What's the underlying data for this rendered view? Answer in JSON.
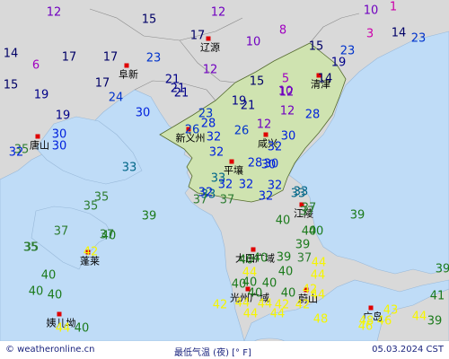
{
  "colors": {
    "temp_0": "#cc00aa",
    "temp_5": "#a000c0",
    "temp_10": "#7000c0",
    "temp_15": "#000066",
    "temp_20": "#000088",
    "temp_25": "#0033cc",
    "temp_30": "#0022dd",
    "temp_33": "#006688",
    "temp_35": "#2e7d32",
    "temp_40": "#1b7a1b",
    "temp_44": "#f5f500",
    "sea": "#bfdcf7",
    "land": "#d9d9d9",
    "korea": "#cfe3b0"
  },
  "footer": {
    "site": "© weatheronline.cn",
    "title": "最低气温 (夜) [° F]",
    "date": "05.03.2024 CST"
  },
  "cities": [
    {
      "name": "辽源"
    },
    {
      "name": "阜新"
    },
    {
      "name": "清津"
    },
    {
      "name": "唐山"
    },
    {
      "name": "新义州"
    },
    {
      "name": "咸兴"
    },
    {
      "name": "平壤"
    },
    {
      "name": "江陵"
    },
    {
      "name": "蓬莱"
    },
    {
      "name": "大田广域"
    },
    {
      "name": "光州广域"
    },
    {
      "name": "蔚山"
    },
    {
      "name": "姨儿坳"
    },
    {
      "name": "广岛"
    }
  ],
  "temps": [
    {
      "v": "12"
    },
    {
      "v": "15"
    },
    {
      "v": "12"
    },
    {
      "v": "10"
    },
    {
      "v": "1"
    },
    {
      "v": "17"
    },
    {
      "v": "10"
    },
    {
      "v": "8"
    },
    {
      "v": "15"
    },
    {
      "v": "3"
    },
    {
      "v": "14"
    },
    {
      "v": "23"
    },
    {
      "v": "14"
    },
    {
      "v": "6"
    },
    {
      "v": "17"
    },
    {
      "v": "17"
    },
    {
      "v": "23"
    },
    {
      "v": "12"
    },
    {
      "v": "19"
    },
    {
      "v": "23"
    },
    {
      "v": "15"
    },
    {
      "v": "19"
    },
    {
      "v": "17"
    },
    {
      "v": "21"
    },
    {
      "v": "15"
    },
    {
      "v": "5"
    },
    {
      "v": "14"
    },
    {
      "v": "24"
    },
    {
      "v": "21"
    },
    {
      "v": "12"
    },
    {
      "v": "10"
    },
    {
      "v": "19"
    },
    {
      "v": "21"
    },
    {
      "v": "30"
    },
    {
      "v": "19"
    },
    {
      "v": "21"
    },
    {
      "v": "12"
    },
    {
      "v": "28"
    },
    {
      "v": "23"
    },
    {
      "v": "28"
    },
    {
      "v": "12"
    },
    {
      "v": "30"
    },
    {
      "v": "26"
    },
    {
      "v": "32"
    },
    {
      "v": "26"
    },
    {
      "v": "30"
    },
    {
      "v": "35"
    },
    {
      "v": "30"
    },
    {
      "v": "32"
    },
    {
      "v": "32"
    },
    {
      "v": "30"
    },
    {
      "v": "32"
    },
    {
      "v": "28"
    },
    {
      "v": "30"
    },
    {
      "v": "33"
    },
    {
      "v": "33"
    },
    {
      "v": "32"
    },
    {
      "v": "32"
    },
    {
      "v": "32"
    },
    {
      "v": "33"
    },
    {
      "v": "33"
    },
    {
      "v": "37"
    },
    {
      "v": "37"
    },
    {
      "v": "32"
    },
    {
      "v": "33"
    },
    {
      "v": "32"
    },
    {
      "v": "37"
    },
    {
      "v": "35"
    },
    {
      "v": "35"
    },
    {
      "v": "39"
    },
    {
      "v": "37"
    },
    {
      "v": "40"
    },
    {
      "v": "39"
    },
    {
      "v": "37"
    },
    {
      "v": "37"
    },
    {
      "v": "40"
    },
    {
      "v": "40"
    },
    {
      "v": "35"
    },
    {
      "v": "35"
    },
    {
      "v": "42"
    },
    {
      "v": "40"
    },
    {
      "v": "40"
    },
    {
      "v": "39"
    },
    {
      "v": "37"
    },
    {
      "v": "39"
    },
    {
      "v": "40"
    },
    {
      "v": "40"
    },
    {
      "v": "40"
    },
    {
      "v": "44"
    },
    {
      "v": "40"
    },
    {
      "v": "40"
    },
    {
      "v": "44"
    },
    {
      "v": "40"
    },
    {
      "v": "40"
    },
    {
      "v": "44"
    },
    {
      "v": "40"
    },
    {
      "v": "40"
    },
    {
      "v": "44"
    },
    {
      "v": "40"
    },
    {
      "v": "42"
    },
    {
      "v": "44"
    },
    {
      "v": "44"
    },
    {
      "v": "42"
    },
    {
      "v": "44"
    },
    {
      "v": "42"
    },
    {
      "v": "42"
    },
    {
      "v": "44"
    },
    {
      "v": "48"
    },
    {
      "v": "44"
    },
    {
      "v": "40"
    },
    {
      "v": "46"
    },
    {
      "v": "43"
    },
    {
      "v": "48"
    },
    {
      "v": "46"
    },
    {
      "v": "44"
    },
    {
      "v": "39"
    },
    {
      "v": "41"
    },
    {
      "v": "39"
    }
  ]
}
